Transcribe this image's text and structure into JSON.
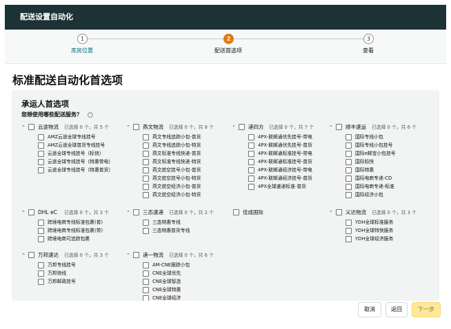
{
  "window": {
    "title": "配送设置自动化"
  },
  "stepper": {
    "steps": [
      {
        "number": "1",
        "label": "库房位置"
      },
      {
        "number": "2",
        "label": "配送首选项"
      },
      {
        "number": "3",
        "label": "查看"
      }
    ]
  },
  "page": {
    "title": "标准配送自动化首选项"
  },
  "panel": {
    "title": "承运人首选项",
    "subtitle": "您想使用哪些配送服务？",
    "info_icon": "i"
  },
  "groups": [
    {
      "name": "云途物流",
      "count": "已选择 0 个，共 5 个",
      "items": [
        "AMZ云途全球专线挂号",
        "AMZ云途全球普货专线挂号",
        "云途全球专线挂号（标快）",
        "云途全球专线挂号（特惠带电）",
        "云途全球专线挂号（特惠普货）"
      ]
    },
    {
      "name": "燕文物流",
      "count": "已选择 0 个，共 8 个",
      "items": [
        "燕文专线追踪小包-普货",
        "燕文专线追踪小包-特货",
        "燕文标准专线快递-普货",
        "燕文标准专线快递-特货",
        "燕文航空挂号小包-普货",
        "燕文航空挂号小包-特货",
        "燕文航空经济小包-普货",
        "燕文航空经济小包-特货"
      ]
    },
    {
      "name": "递四方",
      "count": "已选择 0 个，共 7 个",
      "items": [
        "4PX-联邮通优先挂号-带电",
        "4PX-联邮通优先挂号-普货",
        "4PX-联邮通标准挂号-带电",
        "4PX-联邮通标准挂号-普货",
        "4PX-联邮通经济挂号-带电",
        "4PX-联邮通经济挂号-普货",
        "4PX全球速递标准-普货"
      ]
    },
    {
      "name": "顺丰速运",
      "count": "已选择 0 个，共 6 个",
      "items": [
        "国际专线小包",
        "国际专线小包挂号",
        "国际e邮宝小包挂号",
        "国际标快",
        "国际特惠",
        "国际电商专递-CD",
        "国际电商专递-标准",
        "国际经济小包"
      ]
    },
    {
      "name": "DHL eC",
      "count": "已选择 0 个，共 3 个",
      "items": [
        "跨境电商专线标准包裹(普)",
        "跨境电商专线标准包裹(带)",
        "跨境电商可追踪包裹"
      ]
    },
    {
      "name": "三态速递",
      "count": "已选择 0 个，共 2 个",
      "items": [
        "三态特惠专线",
        "三态特惠普货专线"
      ]
    },
    {
      "name": "佳成国际",
      "count": "",
      "items": []
    },
    {
      "name": "义达物流",
      "count": "已选择 0 个，共 3 个",
      "items": [
        "YDH全球标准服务",
        "YDH全球特快服务",
        "YDH全球经济服务"
      ]
    },
    {
      "name": "万邦速达",
      "count": "已选择 0 个，共 3 个",
      "items": [
        "万邦专线挂号",
        "万邦快线",
        "万邦邮政挂号"
      ]
    },
    {
      "name": "递一物流",
      "count": "已选择 0 个，共 6 个",
      "items": [
        "AM-CNE跟踪小包",
        "CNE全球优先",
        "CNE全球智选",
        "CNE全球特惠",
        "CNE全球经济"
      ]
    }
  ],
  "footer": {
    "cancel": "取消",
    "back": "返回",
    "next": "下一步"
  },
  "colors": {
    "header_bg": "#1d3234",
    "active_step": "#e47911",
    "primary_button": "#ffe89a",
    "panel_bg": "#f2f3f3"
  }
}
